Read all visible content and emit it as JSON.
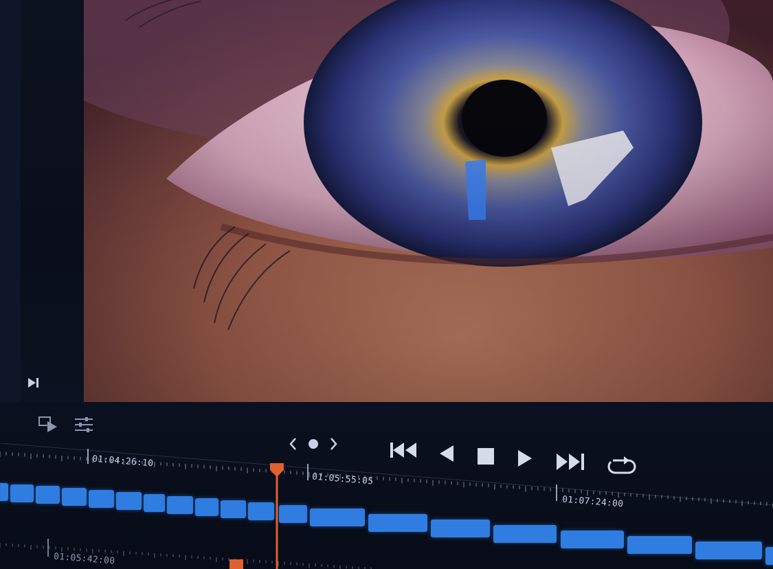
{
  "colors": {
    "clip_blue": "#2f7de0",
    "playhead_orange": "#e0602e",
    "panel_bg": "#0a0e1a",
    "icon_light": "#c9d0e6"
  },
  "viewer": {
    "content": "close-up of a blue eye"
  },
  "toolbar": {
    "left_icons": [
      "skip-to-end-icon",
      "clip-to-timeline-icon",
      "sliders-icon"
    ],
    "marker_nav": [
      "chevron-left-icon",
      "marker-dot-icon",
      "chevron-right-icon"
    ]
  },
  "transport": {
    "buttons": [
      "skip-to-start-icon",
      "play-reverse-icon",
      "stop-icon",
      "play-icon",
      "skip-to-end-icon",
      "loop-icon"
    ]
  },
  "timeline": {
    "ruler_timecodes": [
      "01:04:26:10",
      "01:05:55:05",
      "01:07:24:00"
    ],
    "lower_ruler_timecode": "01:05:42:00"
  }
}
